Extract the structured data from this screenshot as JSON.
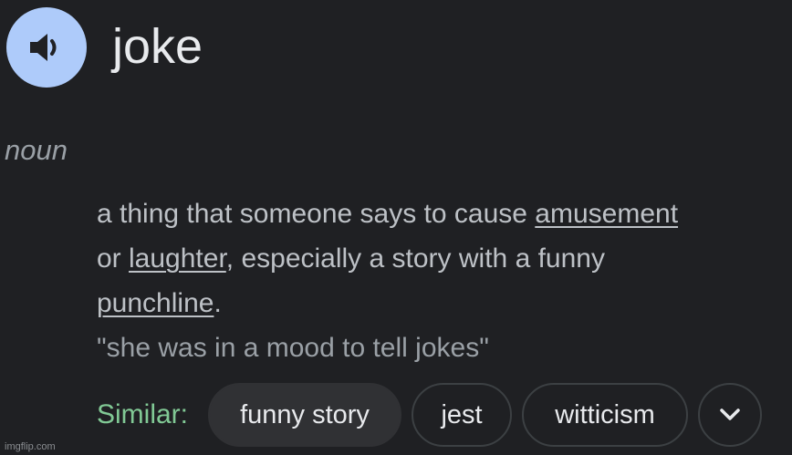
{
  "entry": {
    "word": "joke",
    "part_of_speech": "noun",
    "definition": {
      "line1_text": "a thing that someone says to cause ",
      "line1_link": "amusement",
      "line2_text1": "or ",
      "line2_link": "laughter",
      "line2_text2": ", especially a story with a funny",
      "line3_link": "punchline",
      "line3_text": "."
    },
    "example": "\"she was in a mood to tell jokes\""
  },
  "similar": {
    "label": "Similar:",
    "chips": [
      "funny story",
      "jest",
      "witticism"
    ]
  },
  "icons": {
    "pronounce": "speaker-icon",
    "expand": "chevron-down-icon"
  },
  "colors": {
    "background": "#1f2023",
    "speaker_button": "#aecbfa",
    "similar_label": "#81c995",
    "text_primary": "#e8eaed",
    "text_secondary": "#bdc1c6",
    "text_muted": "#9aa0a6"
  },
  "watermark": "imgflip.com"
}
